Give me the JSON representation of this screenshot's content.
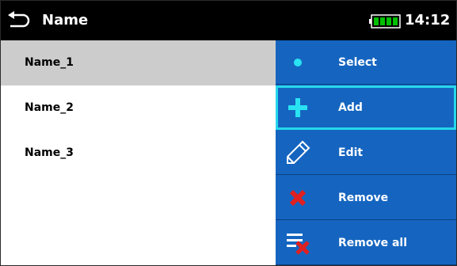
{
  "header": {
    "title": "Name",
    "time": "14:12",
    "back_icon": "back-arrow-icon",
    "battery_icon": "battery-icon",
    "battery_color": "#00c000"
  },
  "list": {
    "items": [
      {
        "label": "Name_1",
        "selected": true
      },
      {
        "label": "Name_2",
        "selected": false
      },
      {
        "label": "Name_3",
        "selected": false
      }
    ]
  },
  "menu": {
    "focused": "Add",
    "items": [
      {
        "label": "Select",
        "icon": "dot-icon"
      },
      {
        "label": "Add",
        "icon": "plus-icon"
      },
      {
        "label": "Edit",
        "icon": "pencil-icon"
      },
      {
        "label": "Remove",
        "icon": "red-x-icon"
      },
      {
        "label": "Remove all",
        "icon": "remove-all-icon"
      }
    ]
  },
  "colors": {
    "header_bg": "#000000",
    "menu_bg": "#1565c0",
    "focus_border": "#26d7ea",
    "selected_row": "#cccccc",
    "remove_red": "#e02020",
    "dot_cyan": "#29e3f2"
  }
}
